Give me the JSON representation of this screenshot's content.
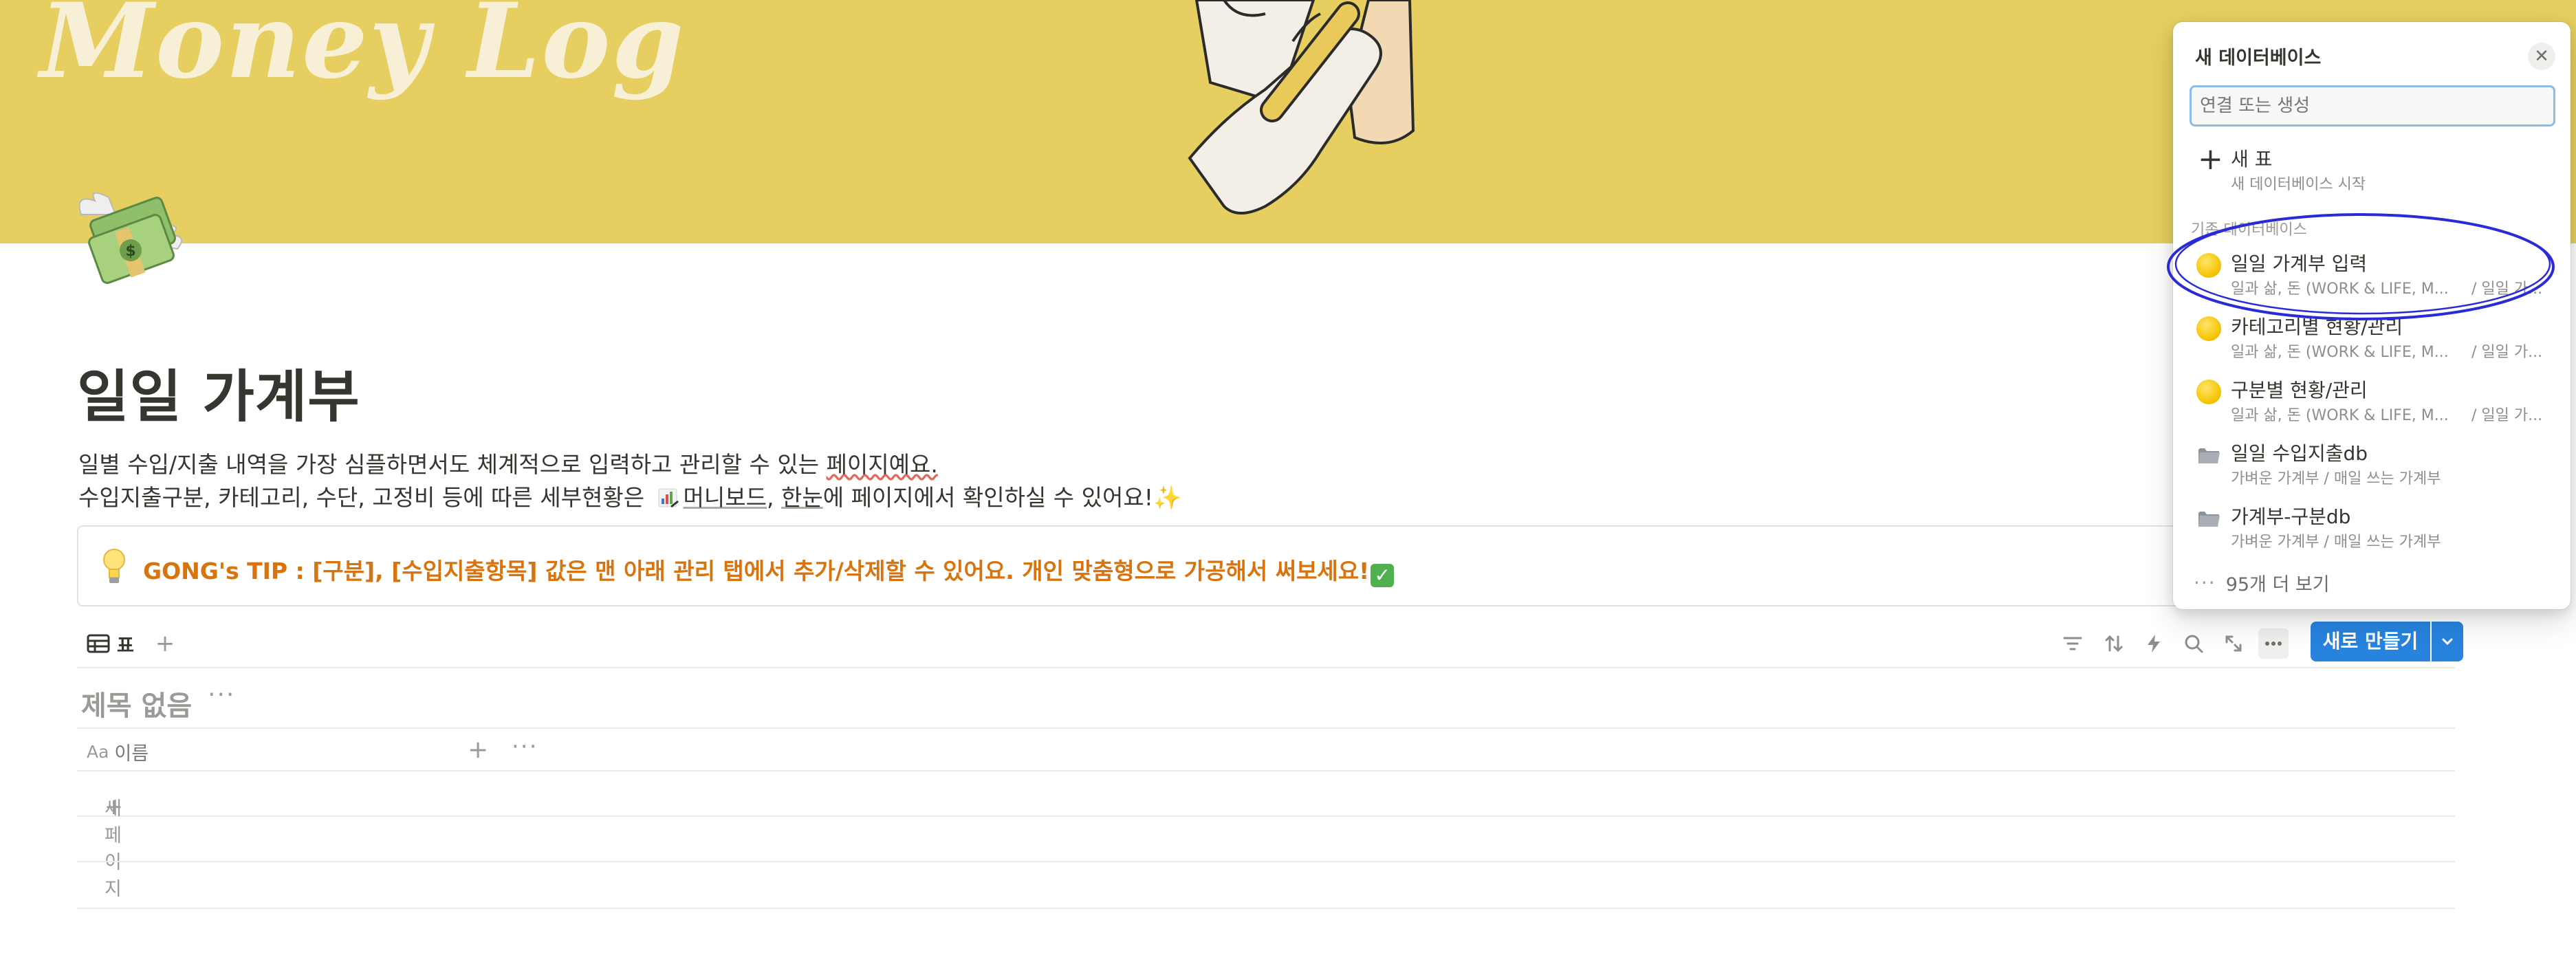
{
  "cover": {
    "title": "Money Log"
  },
  "page": {
    "title": "일일 가계부",
    "desc_line1_a": "일별 수입/지출 내역을 가장 심플하면서도 체계적으로 입력하고 관리할 수 있는 ",
    "desc_line1_b": "페이지예요.",
    "desc_line2_a": "수입지출구분, 카테고리, 수단, 고정비 등에 따른 세부현황은 ",
    "desc_line2_link1": "머니보드",
    "desc_line2_sep": ", ",
    "desc_line2_link2": "한눈",
    "desc_line2_b": "에 페이지에서 확인하실 수 있어요!",
    "sparkle": "✨"
  },
  "callout": {
    "text": "GONG's TIP : [구분], [수입지출항목] 값은 맨 아래 관리 탭에서 추가/삭제할 수 있어요. 개인 맞춤형으로 가공해서 써보세요!",
    "check": "✓"
  },
  "view": {
    "tab_label": "표",
    "new_button": "새로 만들기"
  },
  "database": {
    "title": "제목 없음",
    "column_prefix": "Aa",
    "column_name": "이름",
    "new_page": "새 페이지"
  },
  "popup": {
    "title": "새 데이터베이스",
    "input_placeholder": "연결 또는 생성",
    "new_table": {
      "name": "새 표",
      "sub": "새 데이터베이스 시작"
    },
    "section": "기존 데이터베이스",
    "items": [
      {
        "name": "일일 가계부 입력",
        "sub": "일과 삶, 돈 (WORK & LIFE, M...",
        "path": "/ 일일 가..."
      },
      {
        "name": "카테고리별 현황/관리",
        "sub": "일과 삶, 돈 (WORK & LIFE, M...",
        "path": "/ 일일 가..."
      },
      {
        "name": "구분별 현황/관리",
        "sub": "일과 삶, 돈 (WORK & LIFE, M...",
        "path": "/ 일일 가..."
      },
      {
        "name": "일일 수입지출db",
        "sub": "가벼운 가계부 / 매일 쓰는 가계부",
        "path": ""
      },
      {
        "name": "가계부-구분db",
        "sub": "가벼운 가계부 / 매일 쓰는 가계부",
        "path": ""
      }
    ],
    "more": "95개 더 보기"
  },
  "colors": {
    "cover": "#e6cf60",
    "accent": "#2783de",
    "tip": "#d9730d",
    "annotation": "#2a2ad6"
  }
}
